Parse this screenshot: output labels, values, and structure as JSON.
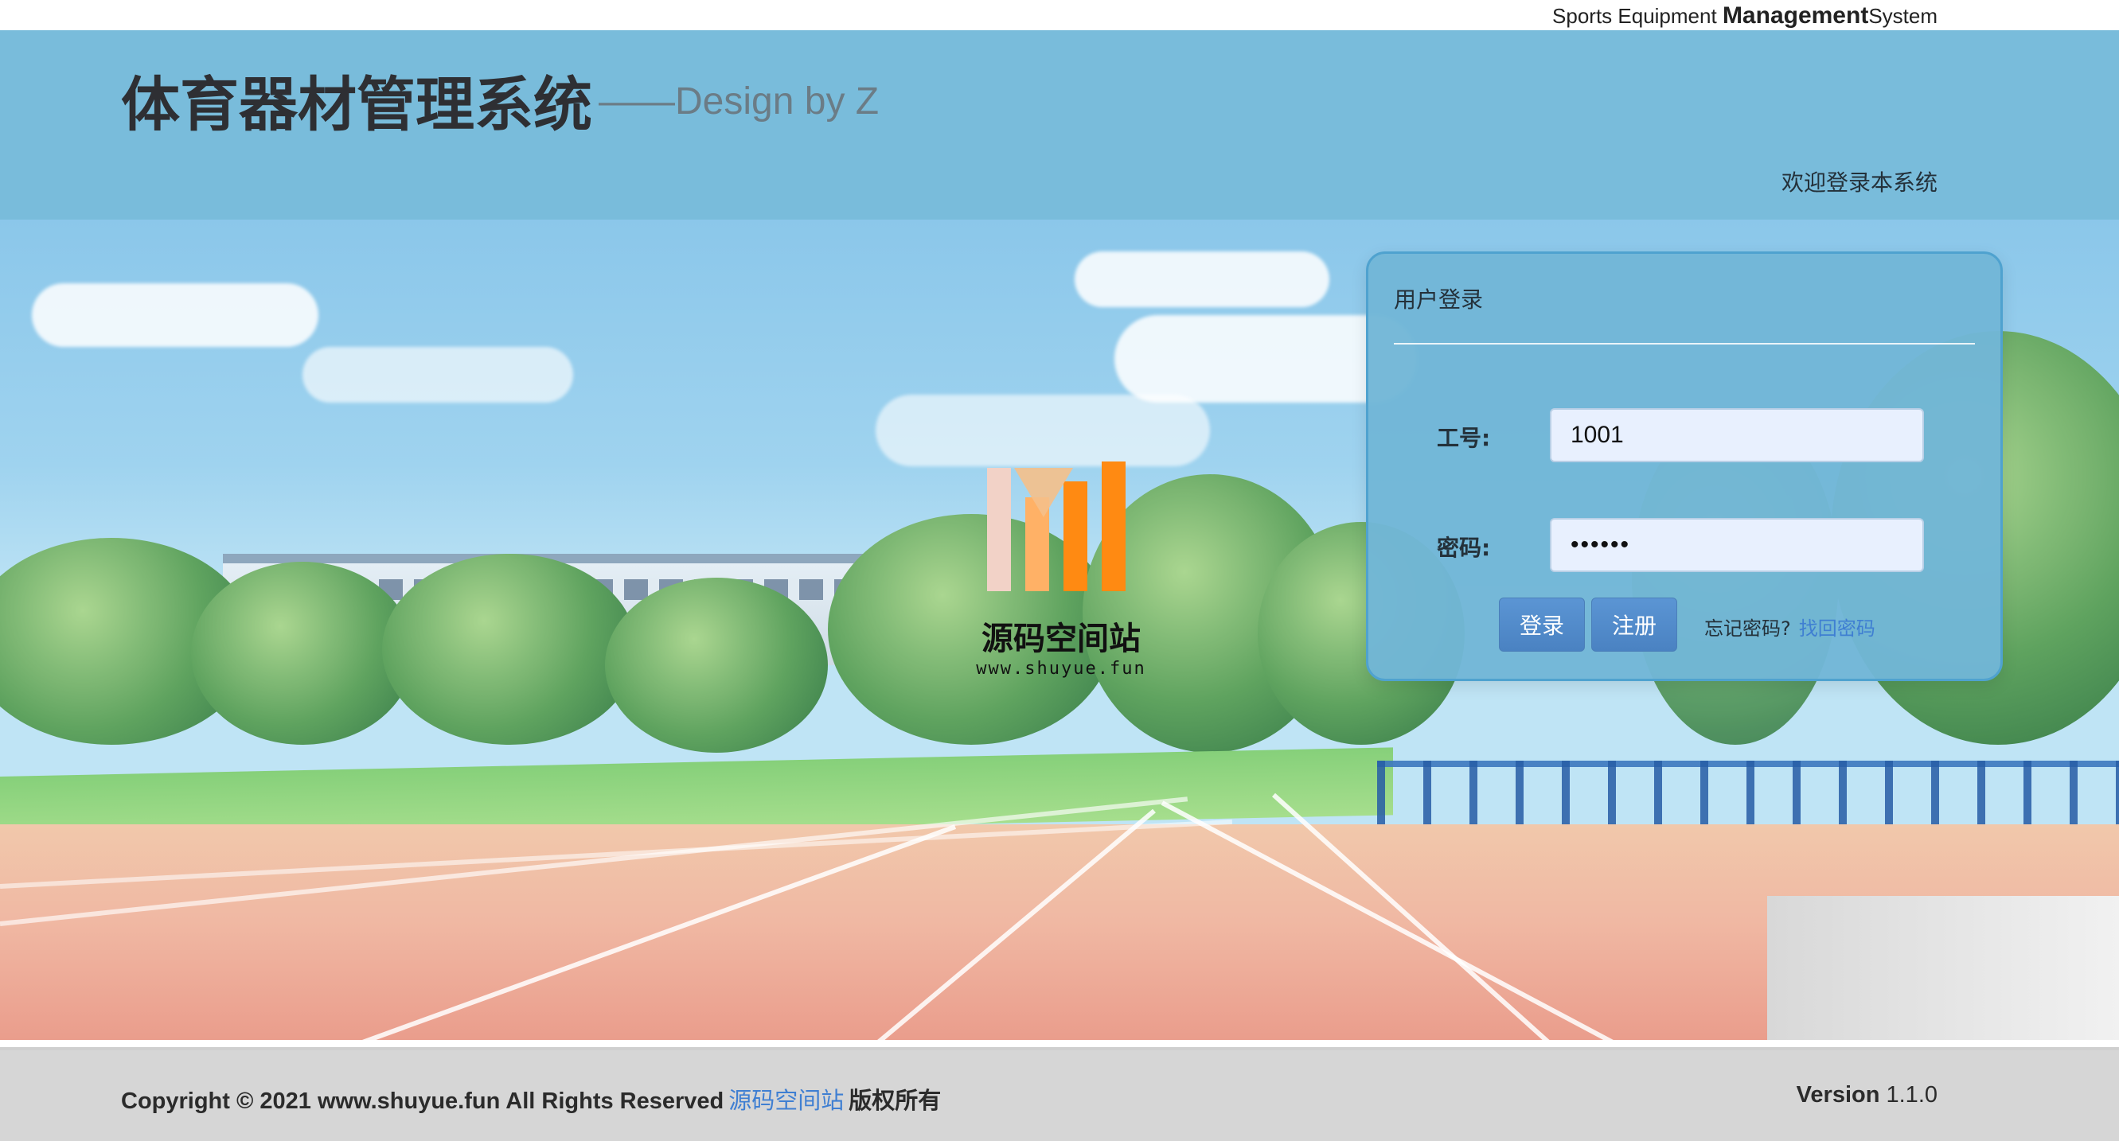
{
  "top_strip": {
    "brand_prefix": "Sports Equipment",
    "brand_strong": "Management",
    "brand_suffix": "System"
  },
  "header": {
    "title": "体育器材管理系统",
    "design_credit": "——Design by Z",
    "welcome": "欢迎登录本系统"
  },
  "watermark": {
    "name": "源码空间站",
    "url": "www.shuyue.fun",
    "colors": {
      "bar_pink": "#f2d2c7",
      "bar_orange": "#ff8a12",
      "bar_light_orange": "#ffb166"
    }
  },
  "login": {
    "panel_title": "用户登录",
    "employee_id_label": "工号:",
    "employee_id_value": "1001",
    "password_label": "密码:",
    "password_value": "••••••",
    "login_button": "登录",
    "register_button": "注册",
    "forgot_text": "忘记密码?",
    "recover_link": "找回密码",
    "colors": {
      "panel_bg": "#71b6d6",
      "button_bg": "#4a82c2",
      "link": "#3f7fd2"
    }
  },
  "footer": {
    "copyright_text": "Copyright © 2021 www.shuyue.fun All Rights Reserved",
    "copyright_link": "源码空间站",
    "rights_cn": "版权所有",
    "version_label": "Version",
    "version_value": "1.1.0"
  }
}
